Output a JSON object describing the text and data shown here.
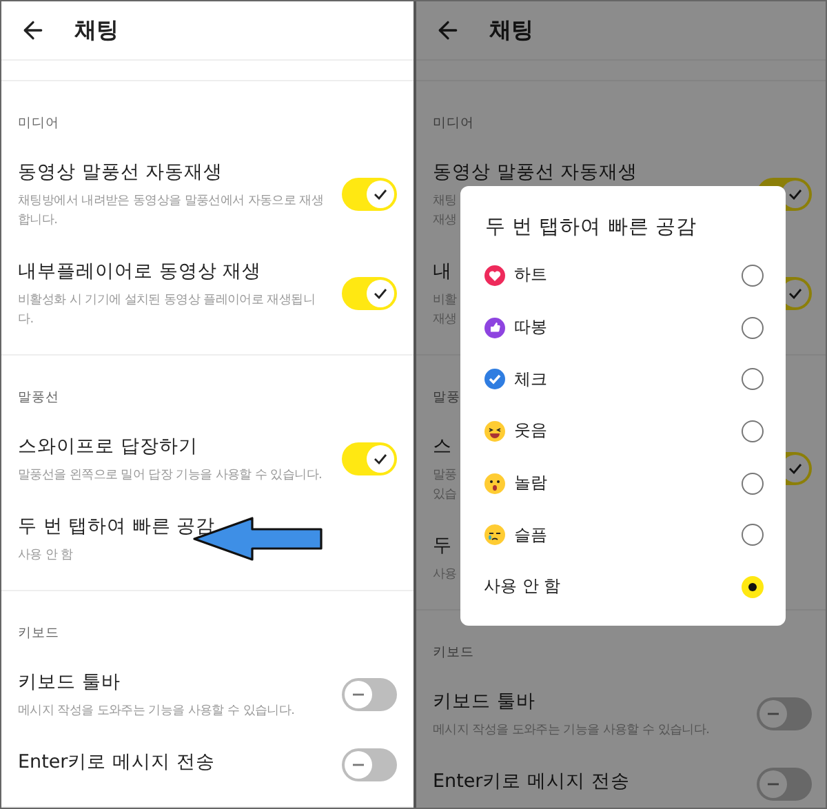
{
  "screens": [
    {
      "header": {
        "title": "채팅"
      },
      "sections": [
        {
          "heading": "미디어",
          "items": [
            {
              "kind": "toggle",
              "title": "동영상 말풍선 자동재생",
              "description": "채팅방에서 내려받은 동영상을 말풍선에서 자동으로 재생합니다.",
              "on": true
            },
            {
              "kind": "toggle",
              "title": "내부플레이어로 동영상 재생",
              "description": "비활성화 시 기기에 설치된 동영상 플레이어로 재생됩니다.",
              "on": true
            }
          ]
        },
        {
          "heading": "말풍선",
          "items": [
            {
              "kind": "toggle",
              "title": "스와이프로 답장하기",
              "description": "말풍선을 왼쪽으로 밀어 답장 기능을 사용할 수 있습니다.",
              "on": true
            },
            {
              "kind": "value",
              "title": "두 번 탭하여 빠른 공감",
              "value": "사용 안 함",
              "highlighted": true
            }
          ]
        },
        {
          "heading": "키보드",
          "items": [
            {
              "kind": "toggle",
              "title": "키보드 툴바",
              "description": "메시지 작성을 도와주는 기능을 사용할 수 있습니다.",
              "on": false
            },
            {
              "kind": "toggle",
              "title": "Enter키로 메시지 전송",
              "on": false
            }
          ]
        }
      ]
    },
    {
      "dimmed": true,
      "header": {
        "title": "채팅"
      },
      "sections": [
        {
          "heading": "미디어",
          "items": [
            {
              "kind": "toggle",
              "title": "동영상 말풍선 자동재생",
              "description_lines": [
                "채팅",
                "재생"
              ],
              "on": true
            },
            {
              "kind": "toggle",
              "title": "내",
              "description_lines": [
                "비활",
                "재생"
              ],
              "on": true
            }
          ]
        },
        {
          "heading": "말풍",
          "items": [
            {
              "kind": "toggle",
              "title": "스",
              "description_lines": [
                "말풍",
                "있습"
              ],
              "on": true
            },
            {
              "kind": "value",
              "title": "두",
              "value": "사용"
            }
          ]
        },
        {
          "heading": "키보드",
          "items": [
            {
              "kind": "toggle",
              "title": "키보드 툴바",
              "description": "메시지 작성을 도와주는 기능을 사용할 수 있습니다.",
              "on": false
            },
            {
              "kind": "toggle",
              "title": "Enter키로 메시지 전송",
              "on": false
            }
          ]
        }
      ],
      "dialog": {
        "title": "두 번 탭하여 빠른 공감",
        "options": [
          {
            "kind": "heart",
            "label": "하트",
            "selected": false
          },
          {
            "kind": "thumb",
            "label": "따봉",
            "selected": false
          },
          {
            "kind": "check",
            "label": "체크",
            "selected": false
          },
          {
            "kind": "laugh",
            "label": "웃음",
            "selected": false
          },
          {
            "kind": "surprise",
            "label": "놀람",
            "selected": false
          },
          {
            "kind": "sad",
            "label": "슬픔",
            "selected": false
          },
          {
            "kind": "none",
            "label": "사용 안 함",
            "selected": true
          }
        ]
      }
    }
  ]
}
